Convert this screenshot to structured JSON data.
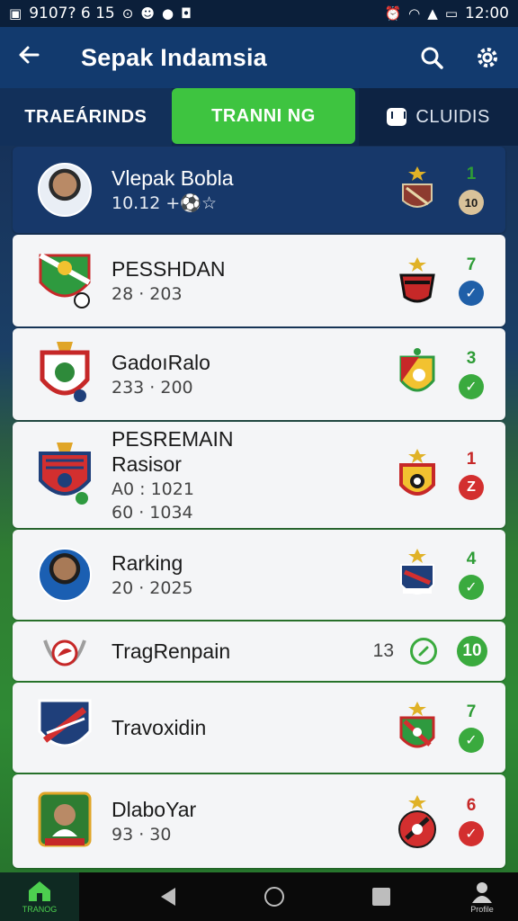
{
  "status_bar": {
    "left_text": "9107? 6 15",
    "time": "12:00"
  },
  "app_bar": {
    "title": "Sepak Indamsia"
  },
  "tabs": [
    {
      "label": "TRAEÁRINDS"
    },
    {
      "label": "TRANNI NG"
    },
    {
      "label": "CLUIDIS"
    }
  ],
  "rows": [
    {
      "name": "Vlepak Bobla",
      "sub": "10.12 +⚽☆",
      "rank": "1",
      "rank_color": "green",
      "status": "10",
      "status_style": "tan",
      "crest": "player-avatar"
    },
    {
      "name": "PESSHDAN",
      "sub": "28 · 203",
      "rank": "7",
      "rank_color": "green",
      "status": "✓",
      "status_style": "blue",
      "crest": "shield-green-red"
    },
    {
      "name": "GadoıRalo",
      "sub": "233 · 200",
      "rank": "3",
      "rank_color": "green",
      "status": "✓",
      "status_style": "green",
      "crest": "shield-red-gold"
    },
    {
      "name": "PESREMAIN",
      "name2": "Rasisor",
      "sub": "A0 : 1021",
      "sub2": "60 · 1034",
      "rank": "1",
      "rank_color": "red",
      "status": "Z",
      "status_style": "red",
      "crest": "shield-red-blue"
    },
    {
      "name": "Rarking",
      "sub": "20 · 2025",
      "rank": "4",
      "rank_color": "green",
      "status": "✓",
      "status_style": "green",
      "crest": "player-avatar-blue"
    },
    {
      "name": "TragRenpain",
      "pending_count": "13",
      "badge": "10",
      "crest": "ball-wing"
    },
    {
      "name": "Travoxidin",
      "rank": "7",
      "rank_color": "green",
      "status": "✓",
      "status_style": "green",
      "crest": "shield-navy-red"
    },
    {
      "name": "DlaboYar",
      "sub": "93 · 30",
      "rank": "6",
      "rank_color": "red",
      "status": "✓",
      "status_style": "red",
      "crest": "player-frame-green"
    }
  ],
  "bottom_nav": {
    "home_label": "TRANOG",
    "profile_label": "Profile"
  },
  "colors": {
    "accent_green": "#3ec440",
    "navy": "#123a6e",
    "alert_red": "#d32f2f",
    "check_blue": "#1f5fa8"
  }
}
